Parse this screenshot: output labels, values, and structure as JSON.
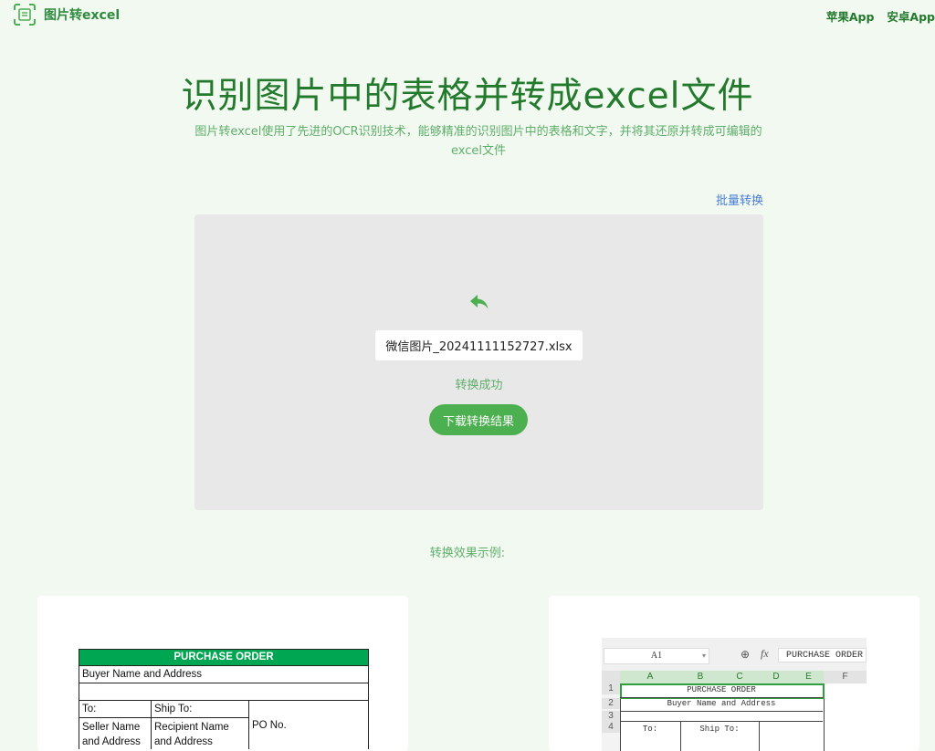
{
  "header": {
    "logo_text": "图片转excel",
    "nav": [
      "苹果App",
      "安卓App"
    ]
  },
  "hero": {
    "title": "识别图片中的表格并转成excel文件",
    "subtitle": "图片转excel使用了先进的OCR识别技术，能够精准的识别图片中的表格和文字，并将其还原并转成可编辑的excel文件"
  },
  "batch_link": "批量转换",
  "converter": {
    "filename": "微信图片_20241111152727.xlsx",
    "status": "转换成功",
    "download_label": "下载转换结果"
  },
  "examples": {
    "title": "转换效果示例:",
    "source_image": {
      "header": "PURCHASE ORDER",
      "buyer": "Buyer Name and Address",
      "to": "To:",
      "ship_to": "Ship To:",
      "seller": "Seller Name and Address",
      "recipient": "Recipient Name and Address",
      "po_no": "PO No."
    },
    "result_image": {
      "name_box": "A1",
      "formula_value": "PURCHASE ORDER",
      "columns": [
        "A",
        "B",
        "C",
        "D",
        "E",
        "F"
      ],
      "rows": [
        "1",
        "2",
        "3",
        "4"
      ],
      "cells": {
        "r1": "PURCHASE ORDER",
        "r2": "Buyer Name and Address",
        "to": "To:",
        "ship_to": "Ship To:"
      }
    }
  },
  "colors": {
    "accent": "#4caf50",
    "title": "#237a2c",
    "subtitle": "#5fae6a",
    "link": "#4a7ed8",
    "background": "#f2f9f1",
    "po_header": "#00a651"
  }
}
